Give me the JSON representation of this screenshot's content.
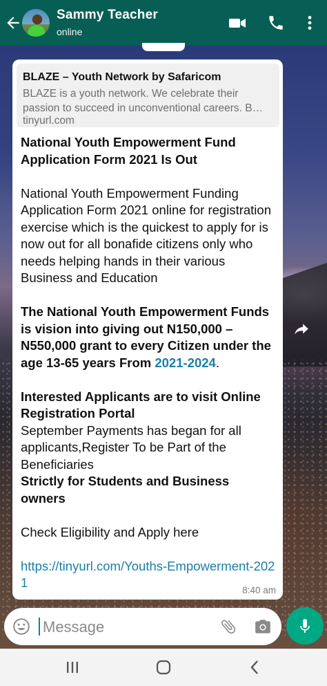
{
  "header": {
    "contact_name": "Sammy Teacher",
    "status": "online",
    "color": "#075e54",
    "icons": [
      "back-arrow-icon",
      "video-call-icon",
      "voice-call-icon",
      "more-options-icon"
    ]
  },
  "message": {
    "link_preview": {
      "title": "BLAZE – Youth Network by Safaricom",
      "description": "BLAZE is a youth network. We celebrate their passion to succeed in unconventional careers. B…",
      "domain": "tinyurl.com"
    },
    "heading": "National Youth Empowerment Fund Application Form 2021 Is Out",
    "paragraph1": "National Youth Empowerment Funding Application Form 2021 online for registration exercise which is the quickest to apply for is now out for all bonafide citizens only who needs helping hands in their various Business and Education",
    "paragraph2_bold": "The National Youth Empowerment Funds is vision into giving out N150,000 – N550,000 grant to every Citizen under the age  13-65 years From ",
    "paragraph2_link": "2021-2024",
    "paragraph2_end": ".",
    "paragraph3_bold": "Interested Applicants are to visit Online Registration Portal",
    "paragraph3_text": "September Payments has began for all applicants,Register To be Part of the Beneficiaries",
    "paragraph3_bold2": "Strictly for Students and Business owners",
    "paragraph4": "Check Eligibility and Apply here",
    "link": "https://tinyurl.com/Youths-Empowerment-2021",
    "time": "8:40 am",
    "link_color": "#1a7ea8"
  },
  "composer": {
    "placeholder": "Message",
    "accent": "#00a884"
  },
  "navbar": {
    "icons": [
      "recent-apps-icon",
      "home-icon",
      "back-icon"
    ]
  }
}
